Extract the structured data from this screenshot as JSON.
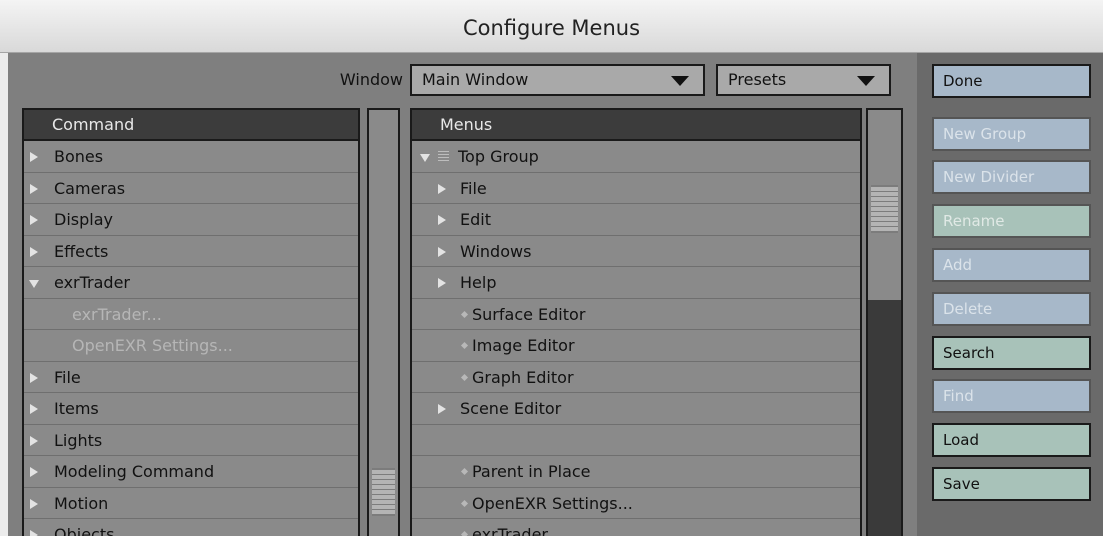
{
  "window": {
    "title": "Configure Menus"
  },
  "toolbar": {
    "window_label": "Window",
    "window_select": "Main Window",
    "presets_select": "Presets"
  },
  "command_list": {
    "header": "Command",
    "items": [
      {
        "label": "Bones",
        "state": "collapsed"
      },
      {
        "label": "Cameras",
        "state": "collapsed"
      },
      {
        "label": "Display",
        "state": "collapsed"
      },
      {
        "label": "Effects",
        "state": "collapsed"
      },
      {
        "label": "exrTrader",
        "state": "expanded"
      },
      {
        "label": "exrTrader...",
        "state": "child-disabled"
      },
      {
        "label": "OpenEXR Settings...",
        "state": "child-disabled"
      },
      {
        "label": "File",
        "state": "collapsed"
      },
      {
        "label": "Items",
        "state": "collapsed"
      },
      {
        "label": "Lights",
        "state": "collapsed"
      },
      {
        "label": "Modeling Command",
        "state": "collapsed"
      },
      {
        "label": "Motion",
        "state": "collapsed"
      },
      {
        "label": "Objects",
        "state": "collapsed"
      }
    ]
  },
  "menus_list": {
    "header": "Menus",
    "items": [
      {
        "label": "Top Group",
        "kind": "group-expanded"
      },
      {
        "label": "File",
        "kind": "submenu"
      },
      {
        "label": "Edit",
        "kind": "submenu"
      },
      {
        "label": "Windows",
        "kind": "submenu"
      },
      {
        "label": "Help",
        "kind": "submenu"
      },
      {
        "label": "Surface Editor",
        "kind": "command"
      },
      {
        "label": "Image Editor",
        "kind": "command"
      },
      {
        "label": "Graph Editor",
        "kind": "command"
      },
      {
        "label": "Scene Editor",
        "kind": "submenu"
      },
      {
        "label": "",
        "kind": "divider"
      },
      {
        "label": "Parent in Place",
        "kind": "command"
      },
      {
        "label": "OpenEXR Settings...",
        "kind": "command"
      },
      {
        "label": "exrTrader...",
        "kind": "command"
      }
    ]
  },
  "buttons": {
    "done": "Done",
    "new_group": "New Group",
    "new_divider": "New Divider",
    "rename": "Rename",
    "add": "Add",
    "delete": "Delete",
    "search": "Search",
    "find": "Find",
    "load": "Load",
    "save": "Save"
  },
  "colors": {
    "panel": "#7f7f7f",
    "button_blue": "#a7b8c9",
    "button_green": "#a8c2b9",
    "header": "#3c3c3c"
  }
}
